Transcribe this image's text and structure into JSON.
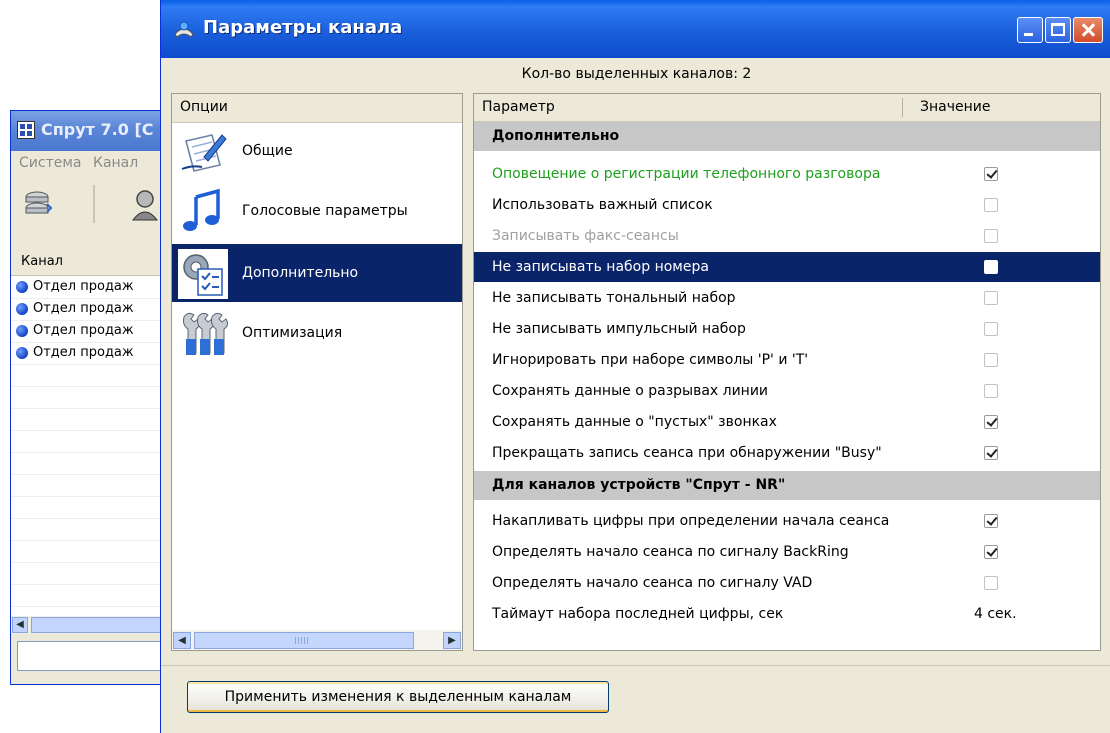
{
  "background_window": {
    "title": "Спрут 7.0 [С",
    "menu": [
      "Система",
      "Канал"
    ],
    "list_header": "Канал",
    "rows": [
      "Отдел продаж",
      "Отдел продаж",
      "Отдел продаж",
      "Отдел продаж"
    ]
  },
  "dialog": {
    "title": "Параметры канала",
    "selected_channels": "Кол-во выделенных каналов: 2",
    "options_header": "Опции",
    "options": [
      {
        "label": "Общие",
        "icon": "notepad-pen-icon",
        "selected": false
      },
      {
        "label": "Голосовые параметры",
        "icon": "music-note-icon",
        "selected": false
      },
      {
        "label": "Дополнительно",
        "icon": "settings-checklist-icon",
        "selected": true
      },
      {
        "label": "Оптимизация",
        "icon": "tools-icon",
        "selected": false
      }
    ],
    "grid_header": {
      "parameter": "Параметр",
      "value": "Значение"
    },
    "groups": [
      {
        "title": "Дополнительно",
        "params": [
          {
            "label": "Оповещение о регистрации телефонного разговора",
            "checked": true,
            "style": "green"
          },
          {
            "label": "Использовать важный список",
            "checked": false
          },
          {
            "label": "Записывать факс-сеансы",
            "checked": false,
            "style": "disabled"
          },
          {
            "label": "Не записывать набор номера",
            "checked": false,
            "selected": true
          },
          {
            "label": "Не записывать тональный набор",
            "checked": false
          },
          {
            "label": "Не записывать импульсный набор",
            "checked": false
          },
          {
            "label": "Игнорировать при наборе символы 'P' и 'T'",
            "checked": false
          },
          {
            "label": "Сохранять данные о разрывах линии",
            "checked": false
          },
          {
            "label": "Сохранять данные о \"пустых\" звонках",
            "checked": true
          },
          {
            "label": "Прекращать запись сеанса при обнаружении \"Busy\"",
            "checked": true
          }
        ]
      },
      {
        "title": "Для каналов устройств \"Спрут - NR\"",
        "params": [
          {
            "label": "Накапливать цифры при определении начала сеанса",
            "checked": true
          },
          {
            "label": "Определять начало сеанса по сигналу BackRing",
            "checked": true
          },
          {
            "label": "Определять начало сеанса по сигналу VAD",
            "checked": false
          },
          {
            "label": "Таймаут набора последней цифры, сек",
            "value": "4 сек."
          }
        ]
      }
    ],
    "apply_button": "Применить изменения к выделенным каналам",
    "colors": {
      "title_blue": "#1a5fdb",
      "selection": "#0a246a",
      "group_bg": "#c7c7c7",
      "green_text": "#1ea01e"
    }
  }
}
